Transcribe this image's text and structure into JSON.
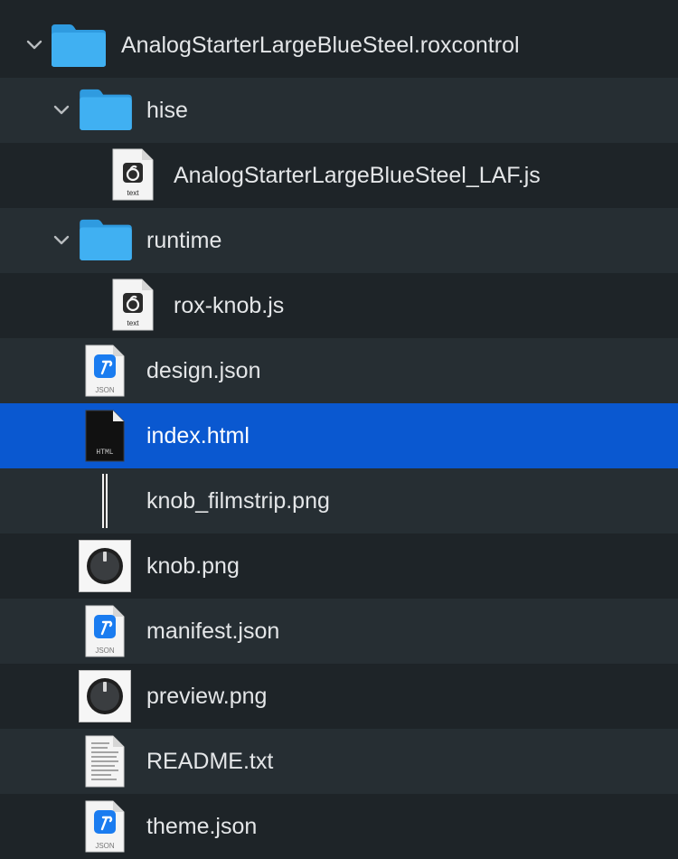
{
  "tree": {
    "root": {
      "name": "AnalogStarterLargeBlueSteel.roxcontrol",
      "icon": "folder-icon",
      "expanded": true
    },
    "hise": {
      "name": "hise",
      "icon": "folder-icon",
      "expanded": true
    },
    "hise_laf": {
      "name": "AnalogStarterLargeBlueSteel_LAF.js",
      "icon": "js-file-icon",
      "badge": "text"
    },
    "runtime": {
      "name": "runtime",
      "icon": "folder-icon",
      "expanded": true
    },
    "runtime_knob": {
      "name": "rox-knob.js",
      "icon": "js-file-icon",
      "badge": "text"
    },
    "design": {
      "name": "design.json",
      "icon": "json-file-icon",
      "badge": "JSON"
    },
    "index": {
      "name": "index.html",
      "icon": "html-file-icon",
      "badge": "HTML",
      "selected": true
    },
    "filmstrip": {
      "name": "knob_filmstrip.png",
      "icon": "filmstrip-thumbnail-icon"
    },
    "knob": {
      "name": "knob.png",
      "icon": "knob-thumbnail-icon"
    },
    "manifest": {
      "name": "manifest.json",
      "icon": "json-file-icon",
      "badge": "JSON"
    },
    "preview": {
      "name": "preview.png",
      "icon": "knob-thumbnail-icon"
    },
    "readme": {
      "name": "README.txt",
      "icon": "text-file-icon"
    },
    "theme": {
      "name": "theme.json",
      "icon": "json-file-icon",
      "badge": "JSON"
    }
  },
  "colors": {
    "selection": "#0a58d0",
    "folder": "#35a8ee",
    "json_accent": "#1a7cf0"
  }
}
